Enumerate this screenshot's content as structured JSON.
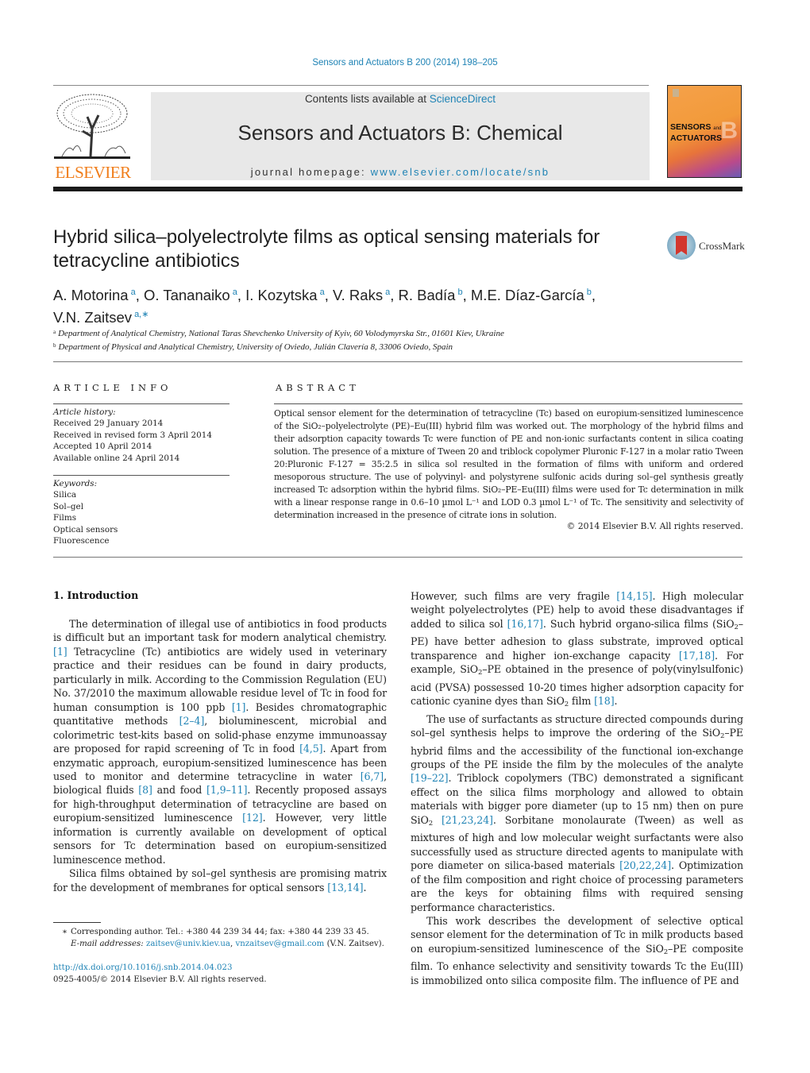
{
  "header": {
    "citation": "Sensors and Actuators B 200 (2014) 198–205",
    "contents_prefix": "Contents lists available at ",
    "contents_link": "ScienceDirect",
    "journal_title": "Sensors and Actuators B: Chemical",
    "homepage_prefix": "journal homepage: ",
    "homepage_link": "www.elsevier.com/locate/snb",
    "publisher_logo_text": "ELSEVIER",
    "cover": {
      "line1": "SENSORS",
      "and": "and",
      "line2": "ACTUATORS",
      "letter": "B"
    },
    "colors": {
      "link": "#1f83b5",
      "elsevier_orange": "#f07d1a"
    }
  },
  "article": {
    "title": "Hybrid silica–polyelectrolyte films as optical sensing materials for tetracycline antibiotics",
    "crossmark_label": "CrossMark",
    "authors": [
      {
        "name": "A. Motorina",
        "aff": "a",
        "sep": ", "
      },
      {
        "name": "O. Tananaiko",
        "aff": "a",
        "sep": ", "
      },
      {
        "name": "I. Kozytska",
        "aff": "a",
        "sep": ", "
      },
      {
        "name": "V. Raks",
        "aff": "a",
        "sep": ", "
      },
      {
        "name": "R. Badía",
        "aff": "b",
        "sep": ", "
      },
      {
        "name": "M.E. Díaz-García",
        "aff": "b",
        "sep": ", "
      },
      {
        "name": "V.N. Zaitsev",
        "aff": "a,∗",
        "sep": ""
      }
    ],
    "affiliations": [
      {
        "key": "a",
        "text": "Department of Analytical Chemistry, National Taras Shevchenko University of Kyiv, 60 Volodymyrska Str., 01601 Kiev, Ukraine"
      },
      {
        "key": "b",
        "text": "Department of Physical and Analytical Chemistry, University of Oviedo, Julián Clavería 8, 33006 Oviedo, Spain"
      }
    ]
  },
  "article_info": {
    "heading": "ARTICLE INFO",
    "history_label": "Article history:",
    "history": [
      "Received 29 January 2014",
      "Received in revised form 3 April 2014",
      "Accepted 10 April 2014",
      "Available online 24 April 2014"
    ],
    "keywords_label": "Keywords:",
    "keywords": [
      "Silica",
      "Sol–gel",
      "Films",
      "Optical sensors",
      "Fluorescence"
    ]
  },
  "abstract": {
    "heading": "ABSTRACT",
    "text": "Optical sensor element for the determination of tetracycline (Tc) based on europium-sensitized luminescence of the SiO₂–polyelectrolyte (PE)–Eu(III) hybrid film was worked out. The morphology of the hybrid films and their adsorption capacity towards Tc were function of PE and non-ionic surfactants content in silica coating solution. The presence of a mixture of Tween 20 and triblock copolymer Pluronic F-127 in a molar ratio Tween 20:Pluronic F-127 = 35:2.5 in silica sol resulted in the formation of films with uniform and ordered mesoporous structure. The use of polyvinyl- and polystyrene sulfonic acids during sol–gel synthesis greatly increased Tc adsorption within the hybrid films. SiO₂–PE–Eu(III) films were used for Tc determination in milk with a linear response range in 0.6–10 µmol L⁻¹ and LOD 0.3 µmol L⁻¹ of Tc. The sensitivity and selectivity of determination increased in the presence of citrate ions in solution.",
    "copyright": "© 2014 Elsevier B.V. All rights reserved."
  },
  "body": {
    "section_heading": "1.  Introduction",
    "left_paragraphs": [
      [
        {
          "t": "The determination of illegal use of antibiotics in food products is difficult but an important task for modern analytical chemistry. "
        },
        {
          "ref": "[1]"
        },
        {
          "t": " Tetracycline (Tc) antibiotics are widely used in veterinary practice and their residues can be found in dairy products, particularly in milk. According to the Commission Regulation (EU) No. 37/2010 the maximum allowable residue level of Tc in food for human consumption is 100 ppb "
        },
        {
          "ref": "[1]"
        },
        {
          "t": ". Besides chromatographic quantitative methods "
        },
        {
          "ref": "[2–4]"
        },
        {
          "t": ", bioluminescent, microbial and colorimetric test-kits based on solid-phase enzyme immunoassay are proposed for rapid screening of Tc in food "
        },
        {
          "ref": "[4,5]"
        },
        {
          "t": ". Apart from enzymatic approach, europium-sensitized luminescence has been used to monitor and determine tetracycline in water "
        },
        {
          "ref": "[6,7]"
        },
        {
          "t": ", biological fluids "
        },
        {
          "ref": "[8]"
        },
        {
          "t": " and food "
        },
        {
          "ref": "[1,9–11]"
        },
        {
          "t": ". Recently proposed assays for high-throughput determination of tetracycline are based on europium-sensitized luminescence "
        },
        {
          "ref": "[12]"
        },
        {
          "t": ". However, very little information is currently available on development of optical sensors for Tc determination based on europium-sensitized luminescence method."
        }
      ],
      [
        {
          "t": "Silica films obtained by sol–gel synthesis are promising matrix for the development of membranes for optical sensors "
        },
        {
          "ref": "[13,14]"
        },
        {
          "t": "."
        }
      ]
    ],
    "right_paragraphs": [
      [
        {
          "t": "However, such films are very fragile "
        },
        {
          "ref": "[14,15]"
        },
        {
          "t": ". High molecular weight polyelectrolytes (PE) help to avoid these disadvantages if added to silica sol "
        },
        {
          "ref": "[16,17]"
        },
        {
          "t": ". Such hybrid organo-silica films (SiO"
        },
        {
          "sub": "2"
        },
        {
          "t": "–PE) have better adhesion to glass substrate, improved optical transparence and higher ion-exchange capacity "
        },
        {
          "ref": "[17,18]"
        },
        {
          "t": ". For example, SiO"
        },
        {
          "sub": "2"
        },
        {
          "t": "–PE obtained in the presence of poly(vinylsulfonic) acid (PVSA) possessed 10-20 times higher adsorption capacity for cationic cyanine dyes than SiO"
        },
        {
          "sub": "2"
        },
        {
          "t": " film "
        },
        {
          "ref": "[18]"
        },
        {
          "t": "."
        }
      ],
      [
        {
          "t": "The use of surfactants as structure directed compounds during sol–gel synthesis helps to improve the ordering of the SiO"
        },
        {
          "sub": "2"
        },
        {
          "t": "–PE hybrid films and the accessibility of the functional ion-exchange groups of the PE inside the film by the molecules of the analyte "
        },
        {
          "ref": "[19–22]"
        },
        {
          "t": ". Triblock copolymers (TBC) demonstrated a significant effect on the silica films morphology and allowed to obtain materials with bigger pore diameter (up to 15 nm) then on pure SiO"
        },
        {
          "sub": "2"
        },
        {
          "t": " "
        },
        {
          "ref": "[21,23,24]"
        },
        {
          "t": ". Sorbitane monolaurate (Tween) as well as mixtures of high and low molecular weight surfactants were also successfully used as structure directed agents to manipulate with pore diameter on silica-based materials "
        },
        {
          "ref": "[20,22,24]"
        },
        {
          "t": ". Optimization of the film composition and right choice of processing parameters are the keys for obtaining films with required sensing performance characteristics."
        }
      ],
      [
        {
          "t": "This work describes the development of selective optical sensor element for the determination of Tc in milk products based on europium-sensitized luminescence of the SiO"
        },
        {
          "sub": "2"
        },
        {
          "t": "–PE composite film. To enhance selectivity and sensitivity towards Tc the Eu(III) is immobilized onto silica composite film. The influence of PE and"
        }
      ]
    ]
  },
  "footnote": {
    "star": "∗",
    "corresponding": "Corresponding author. Tel.: +380 44 239 34 44; fax: +380 44 239 33 45.",
    "email_label": "E-mail addresses:",
    "email_1": "zaitsev@univ.kiev.ua",
    "email_sep": ", ",
    "email_2": "vnzaitsev@gmail.com",
    "email_owner": " (V.N. Zaitsev).",
    "doi": "http://dx.doi.org/10.1016/j.snb.2014.04.023",
    "issn_line": "0925-4005/© 2014 Elsevier B.V. All rights reserved."
  }
}
